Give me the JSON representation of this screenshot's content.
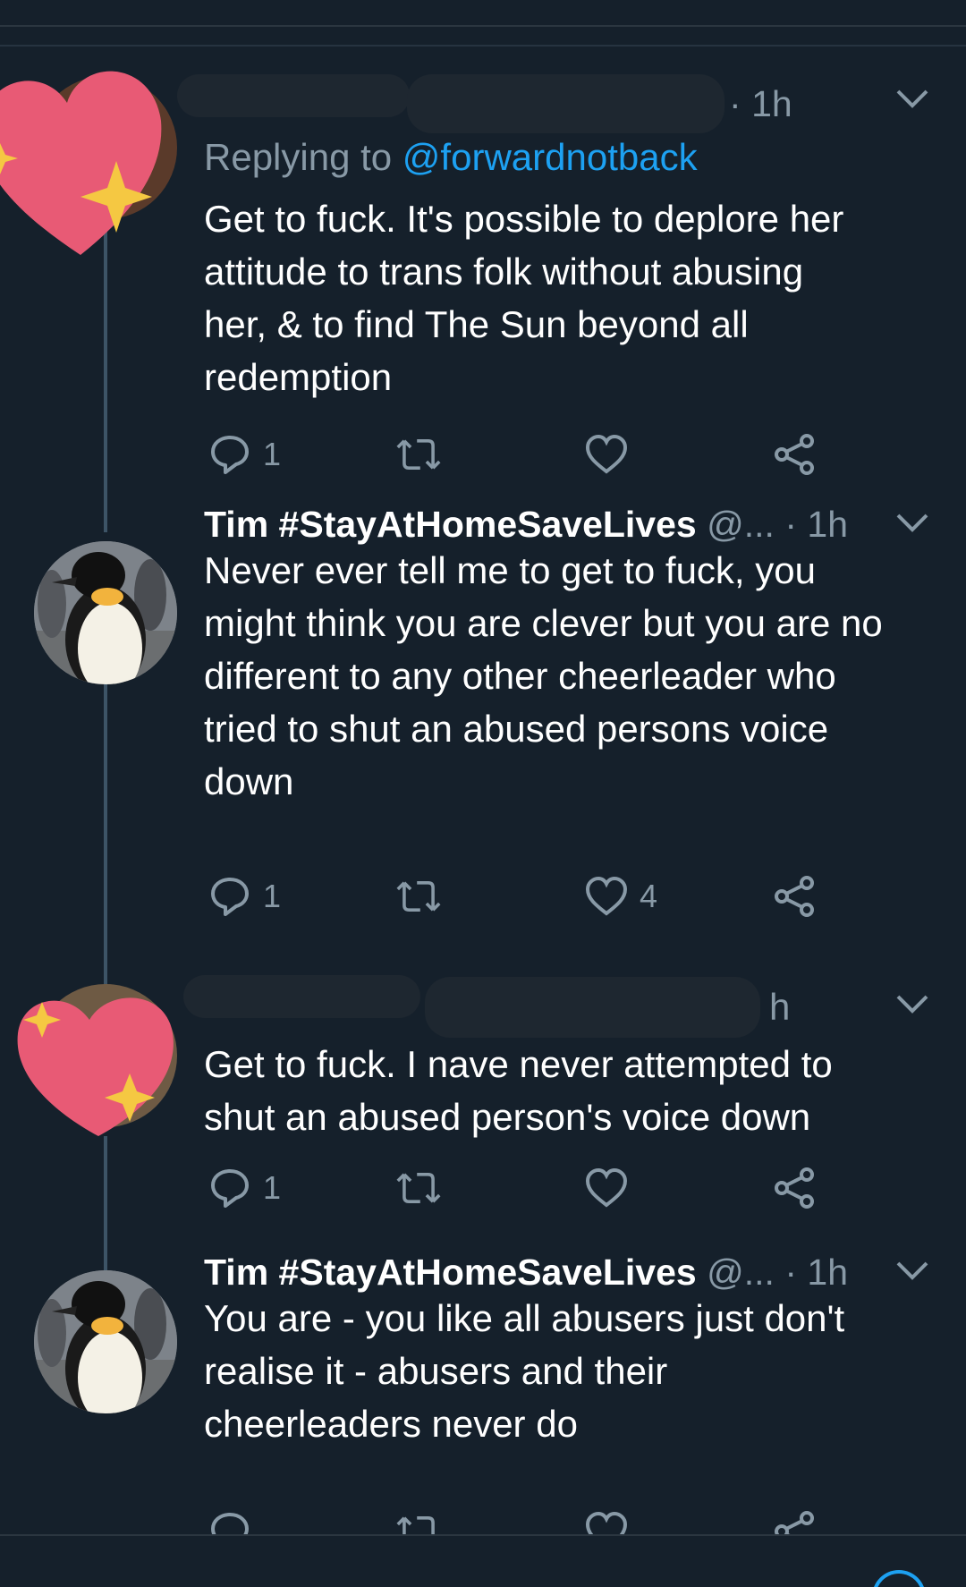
{
  "tweets": [
    {
      "time": "1h",
      "replying_prefix": "Replying to",
      "replying_mention": "@forwardnotback",
      "text": "Get to fuck. It's possible to deplore her attitude to trans folk without abusing her, & to find The Sun beyond all redemption",
      "lines": [
        "Get to fuck. It's possible to deplore her",
        "attitude to trans folk without abusing",
        "her, & to find The Sun beyond all",
        "redemption"
      ],
      "actions": {
        "reply_count": "1",
        "retweet_count": "",
        "like_count": ""
      }
    },
    {
      "name": "Tim #StayAtHomeSaveLives",
      "handle": "@...",
      "separator": "·",
      "time": "1h",
      "lines": [
        "Never ever tell me to get to fuck, you",
        "might think you are clever but you are no",
        "different to any other cheerleader who",
        "tried to shut an abused persons voice",
        "down"
      ],
      "actions": {
        "reply_count": "1",
        "retweet_count": "",
        "like_count": "4"
      }
    },
    {
      "time_fragment": "h",
      "lines": [
        "Get to fuck. I nave never attempted to",
        "shut an abused person's voice down"
      ],
      "actions": {
        "reply_count": "1",
        "retweet_count": "",
        "like_count": ""
      }
    },
    {
      "name": "Tim #StayAtHomeSaveLives",
      "handle": "@...",
      "separator": "·",
      "time": "1h",
      "lines": [
        "You are - you like all abusers just don't",
        "realise it - abusers and their",
        "cheerleaders never do"
      ]
    }
  ],
  "colors": {
    "background": "#15202b",
    "text": "#ffffff",
    "muted": "#8899a6",
    "accent": "#1da1f2",
    "thread_line": "#3d5466",
    "heart_sticker": "#e85a75",
    "sparkle": "#f5c842"
  },
  "icons": [
    "reply-icon",
    "retweet-icon",
    "like-icon",
    "share-icon",
    "chevron-down-icon",
    "heart-sticker",
    "sparkle-icon"
  ]
}
